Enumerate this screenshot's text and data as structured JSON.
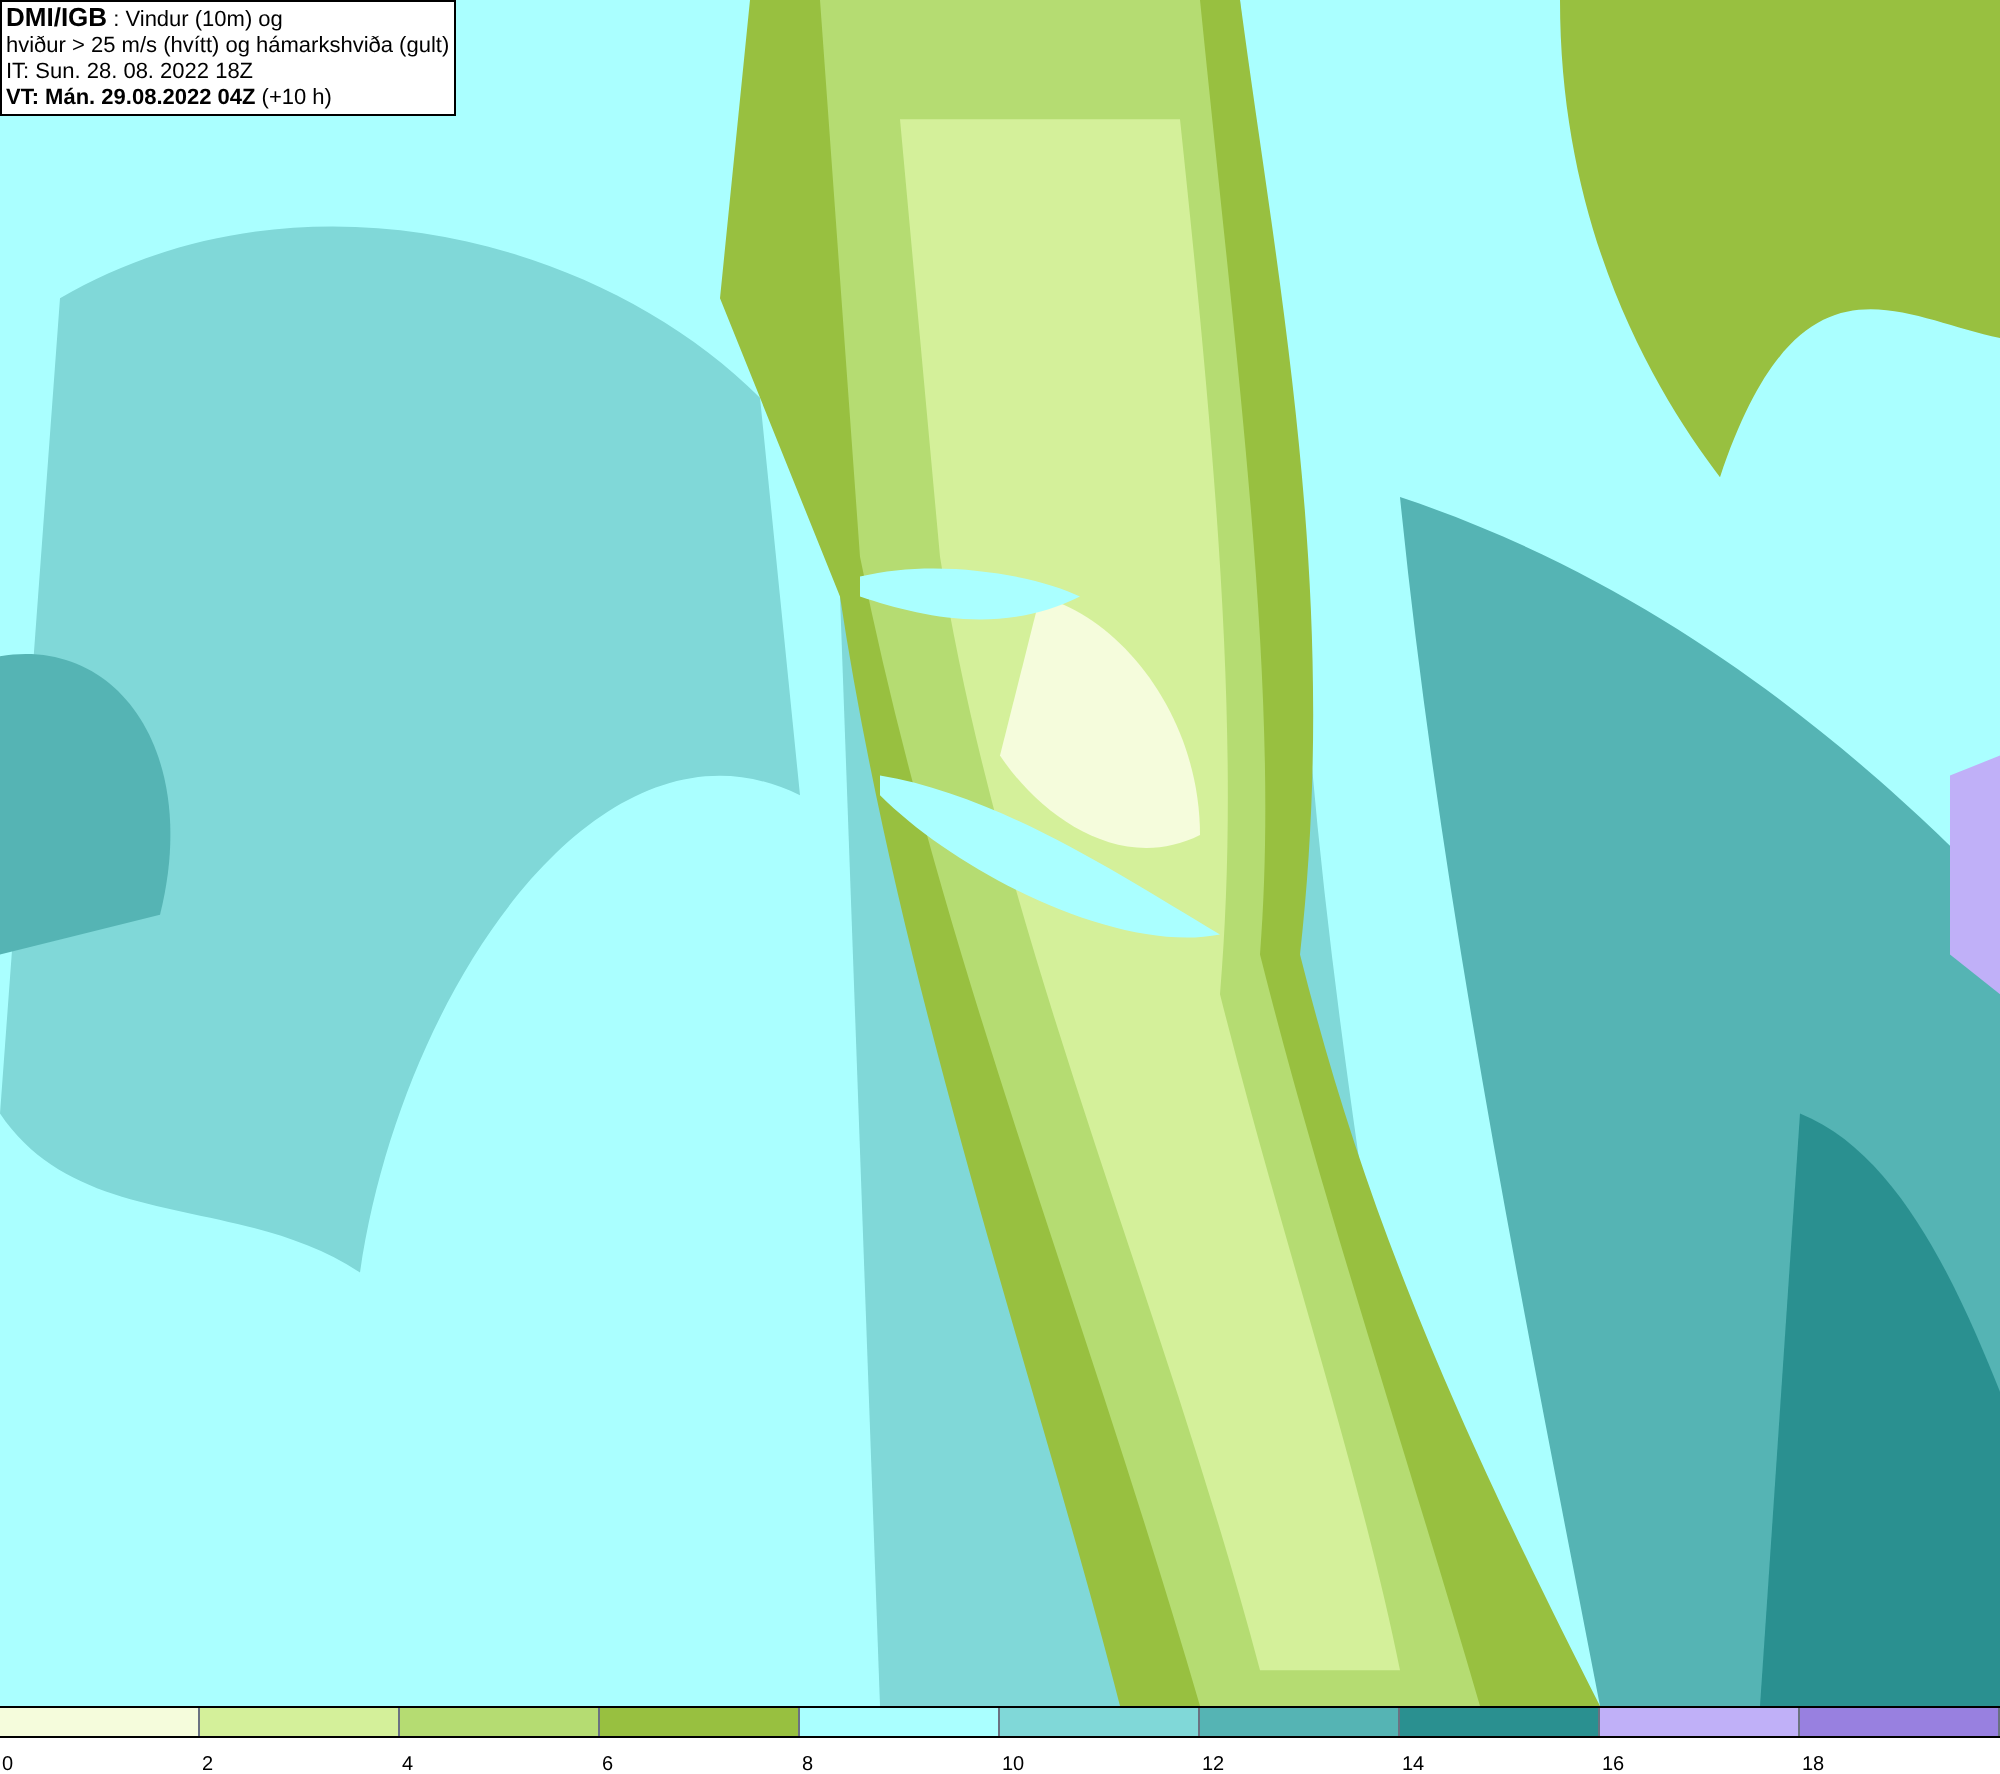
{
  "header": {
    "title": "DMI/IGB",
    "subtitle": ": Vindur (10m) og",
    "line2": "hviður > 25 m/s (hvítt) og hámarkshviða (gult)",
    "issue_time": "IT: Sun. 28. 08. 2022 18Z",
    "valid_time": "VT: Mán. 29.08.2022 04Z",
    "lead": "(+10 h)"
  },
  "legend": {
    "bins": [
      {
        "color": "#f5fcdc",
        "label": "0"
      },
      {
        "color": "#d4f09a",
        "label": "2"
      },
      {
        "color": "#b5dc72",
        "label": "4"
      },
      {
        "color": "#98c040",
        "label": "6"
      },
      {
        "color": "#aaffff",
        "label": "8"
      },
      {
        "color": "#80d8d8",
        "label": "10"
      },
      {
        "color": "#55b4b4",
        "label": "12"
      },
      {
        "color": "#2a9090",
        "label": "14"
      },
      {
        "color": "#c0b0f8",
        "label": "16"
      },
      {
        "color": "#9880e0",
        "label": "18"
      }
    ]
  }
}
